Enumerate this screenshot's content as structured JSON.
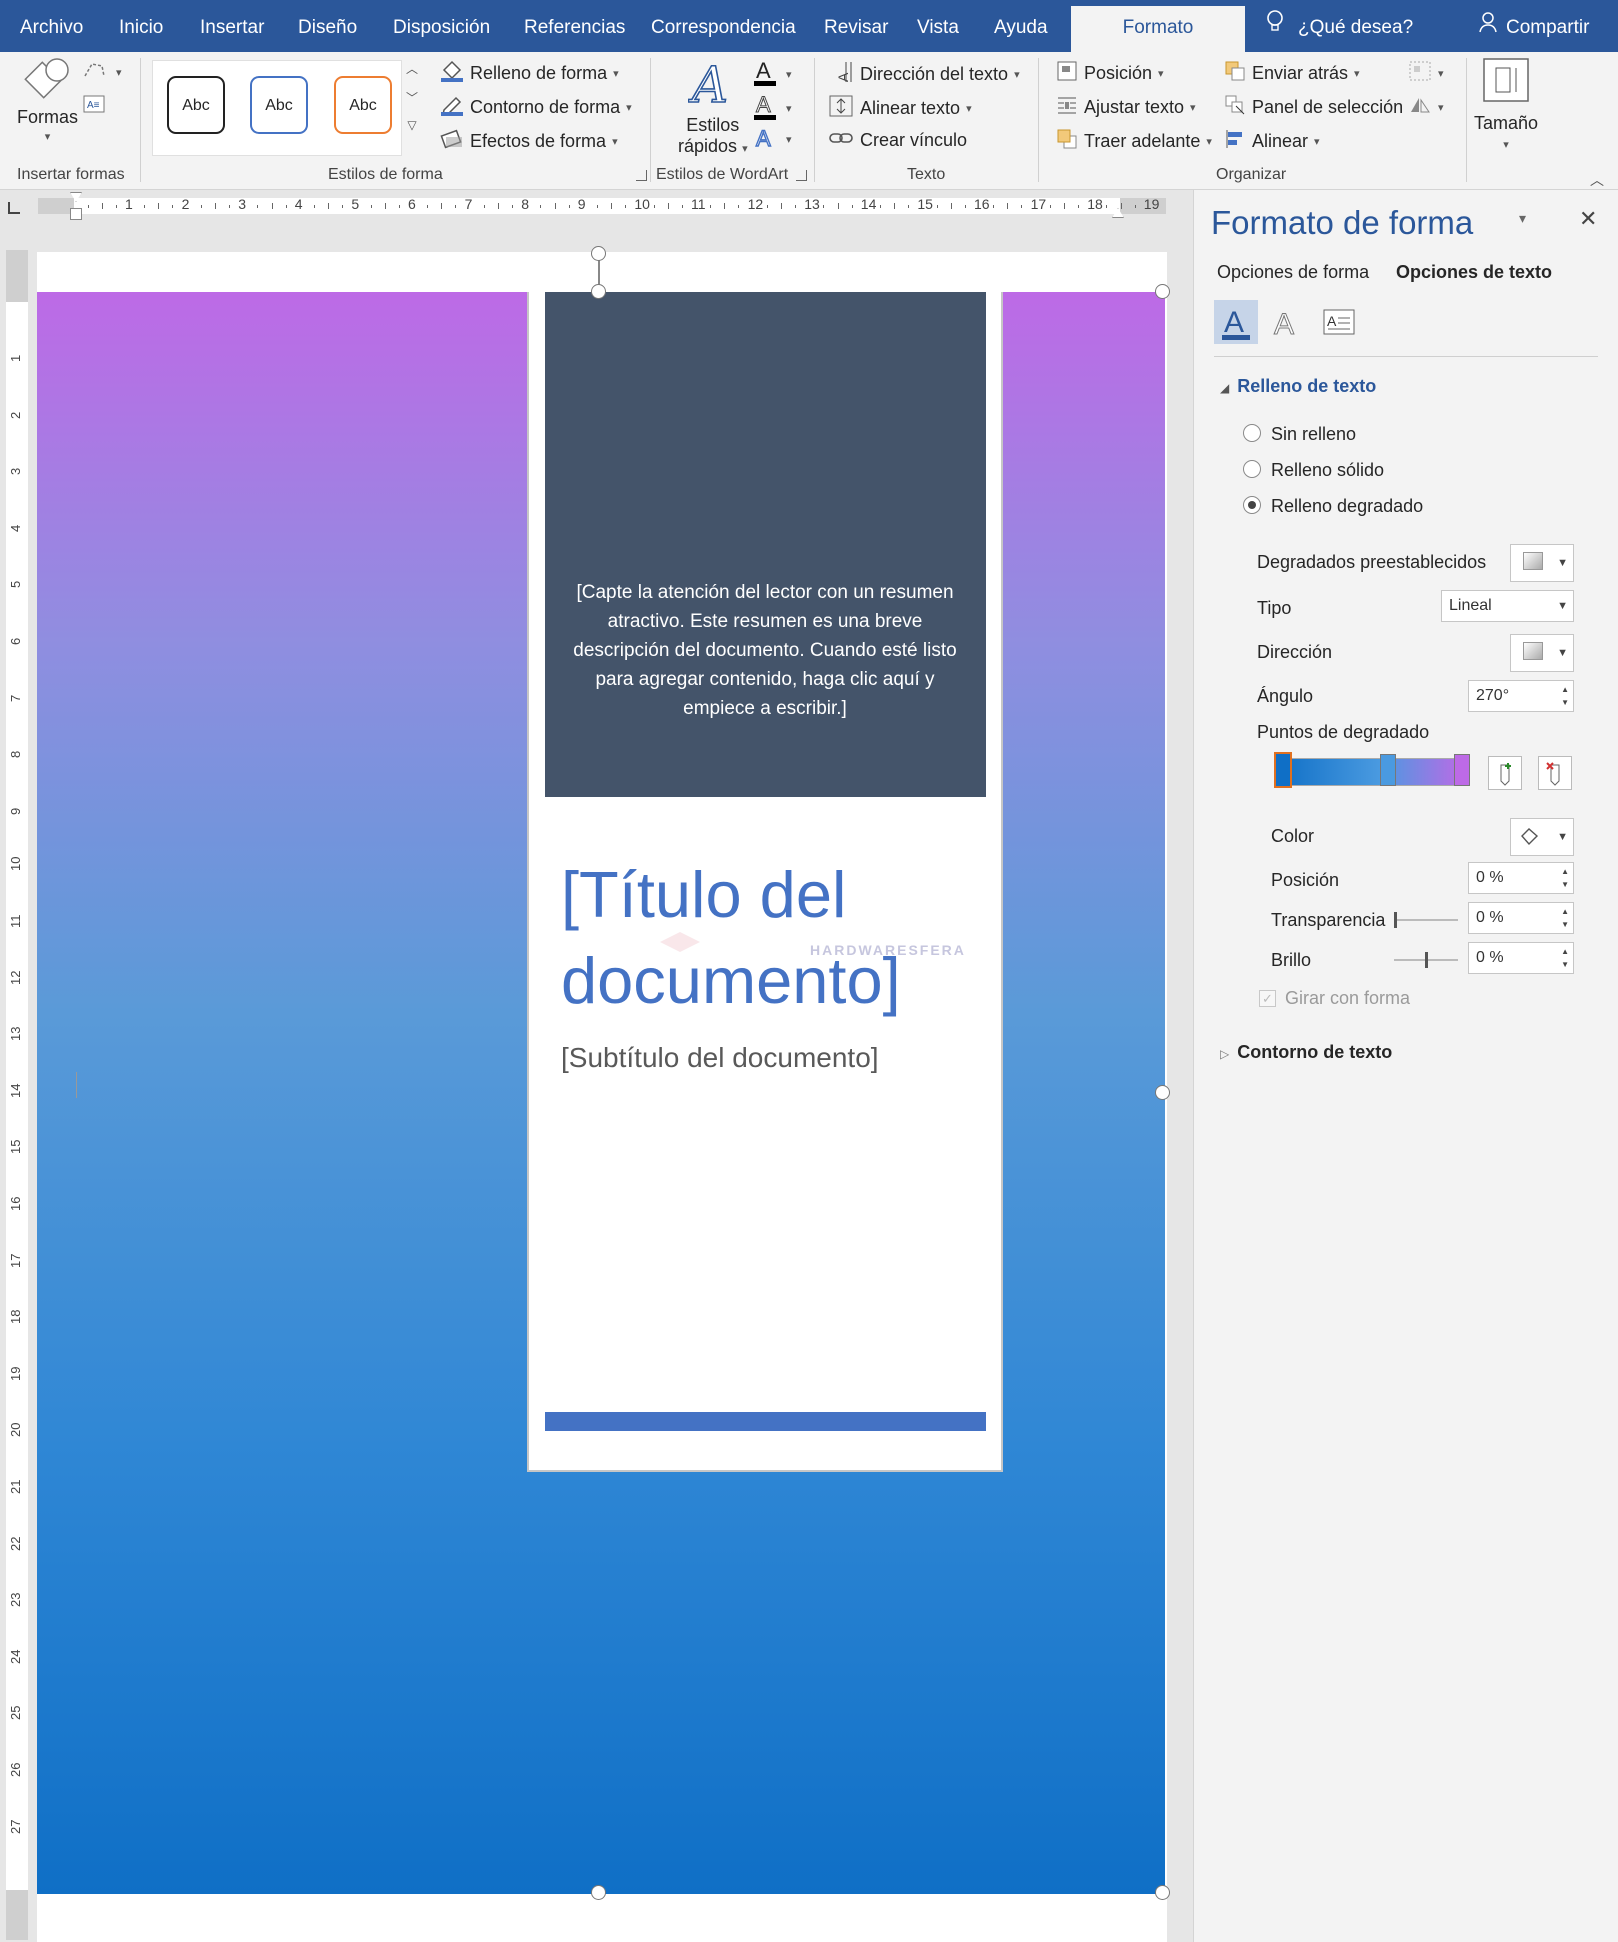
{
  "ribbon_tabs": [
    "Archivo",
    "Inicio",
    "Insertar",
    "Diseño",
    "Disposición",
    "Referencias",
    "Correspondencia",
    "Revisar",
    "Vista",
    "Ayuda",
    "Formato"
  ],
  "active_tab": "Formato",
  "tell_me": "¿Qué desea?",
  "share": "Compartir",
  "ribbon": {
    "shapes_label": "Formas",
    "insert_shapes_group": "Insertar formas",
    "style_samples": [
      "Abc",
      "Abc",
      "Abc"
    ],
    "shape_fill": "Relleno de forma",
    "shape_outline": "Contorno de forma",
    "shape_effects": "Efectos de forma",
    "shape_styles_group": "Estilos de forma",
    "quick_styles_line1": "Estilos",
    "quick_styles_line2": "rápidos",
    "wordart_group": "Estilos de WordArt",
    "text_direction": "Dirección del texto",
    "align_text": "Alinear texto",
    "create_link": "Crear vínculo",
    "text_group": "Texto",
    "position": "Posición",
    "wrap_text": "Ajustar texto",
    "bring_forward": "Traer adelante",
    "send_backward": "Enviar atrás",
    "selection_pane": "Panel de selección",
    "align": "Alinear",
    "arrange_group": "Organizar",
    "size": "Tamaño"
  },
  "ruler_numbers": [
    "1",
    "2",
    "3",
    "4",
    "5",
    "6",
    "7",
    "8",
    "9",
    "10",
    "11",
    "12",
    "13",
    "14",
    "15",
    "16",
    "17",
    "18",
    "19"
  ],
  "vruler_numbers": [
    "1",
    "2",
    "3",
    "4",
    "5",
    "6",
    "7",
    "8",
    "9",
    "10",
    "11",
    "12",
    "13",
    "14",
    "15",
    "16",
    "17",
    "18",
    "19",
    "20",
    "21",
    "22",
    "23",
    "24",
    "25",
    "26",
    "27"
  ],
  "document": {
    "abstract": "[Capte la atención del lector con un resumen atractivo. Este resumen es una breve descripción del documento. Cuando esté listo para agregar contenido, haga clic aquí y empiece a escribir.]",
    "title": "[Título del documento]",
    "subtitle": "[Subtítulo del documento]",
    "watermark": "HARDWARESFERA"
  },
  "pane": {
    "title": "Formato de forma",
    "tab_shape": "Opciones de forma",
    "tab_text": "Opciones de texto",
    "section_fill": "Relleno de texto",
    "opt_no_fill": "Sin relleno",
    "opt_solid": "Relleno sólido",
    "opt_gradient": "Relleno degradado",
    "preset_gradients": "Degradados preestablecidos",
    "type_label": "Tipo",
    "type_value": "Lineal",
    "direction_label": "Dirección",
    "angle_label": "Ángulo",
    "angle_value": "270°",
    "stops_label": "Puntos de degradado",
    "color_label": "Color",
    "position_label": "Posición",
    "position_value": "0 %",
    "transparency_label": "Transparencia",
    "transparency_value": "0 %",
    "brightness_label": "Brillo",
    "brightness_value": "0 %",
    "rotate_label": "Girar con forma",
    "section_outline": "Contorno de texto"
  },
  "colors": {
    "accent": "#2b579a",
    "gradient_top": "#bd6ae6",
    "gradient_bottom": "#0f6fc6",
    "dark_box": "#44546a",
    "title_blue": "#4472c4"
  }
}
